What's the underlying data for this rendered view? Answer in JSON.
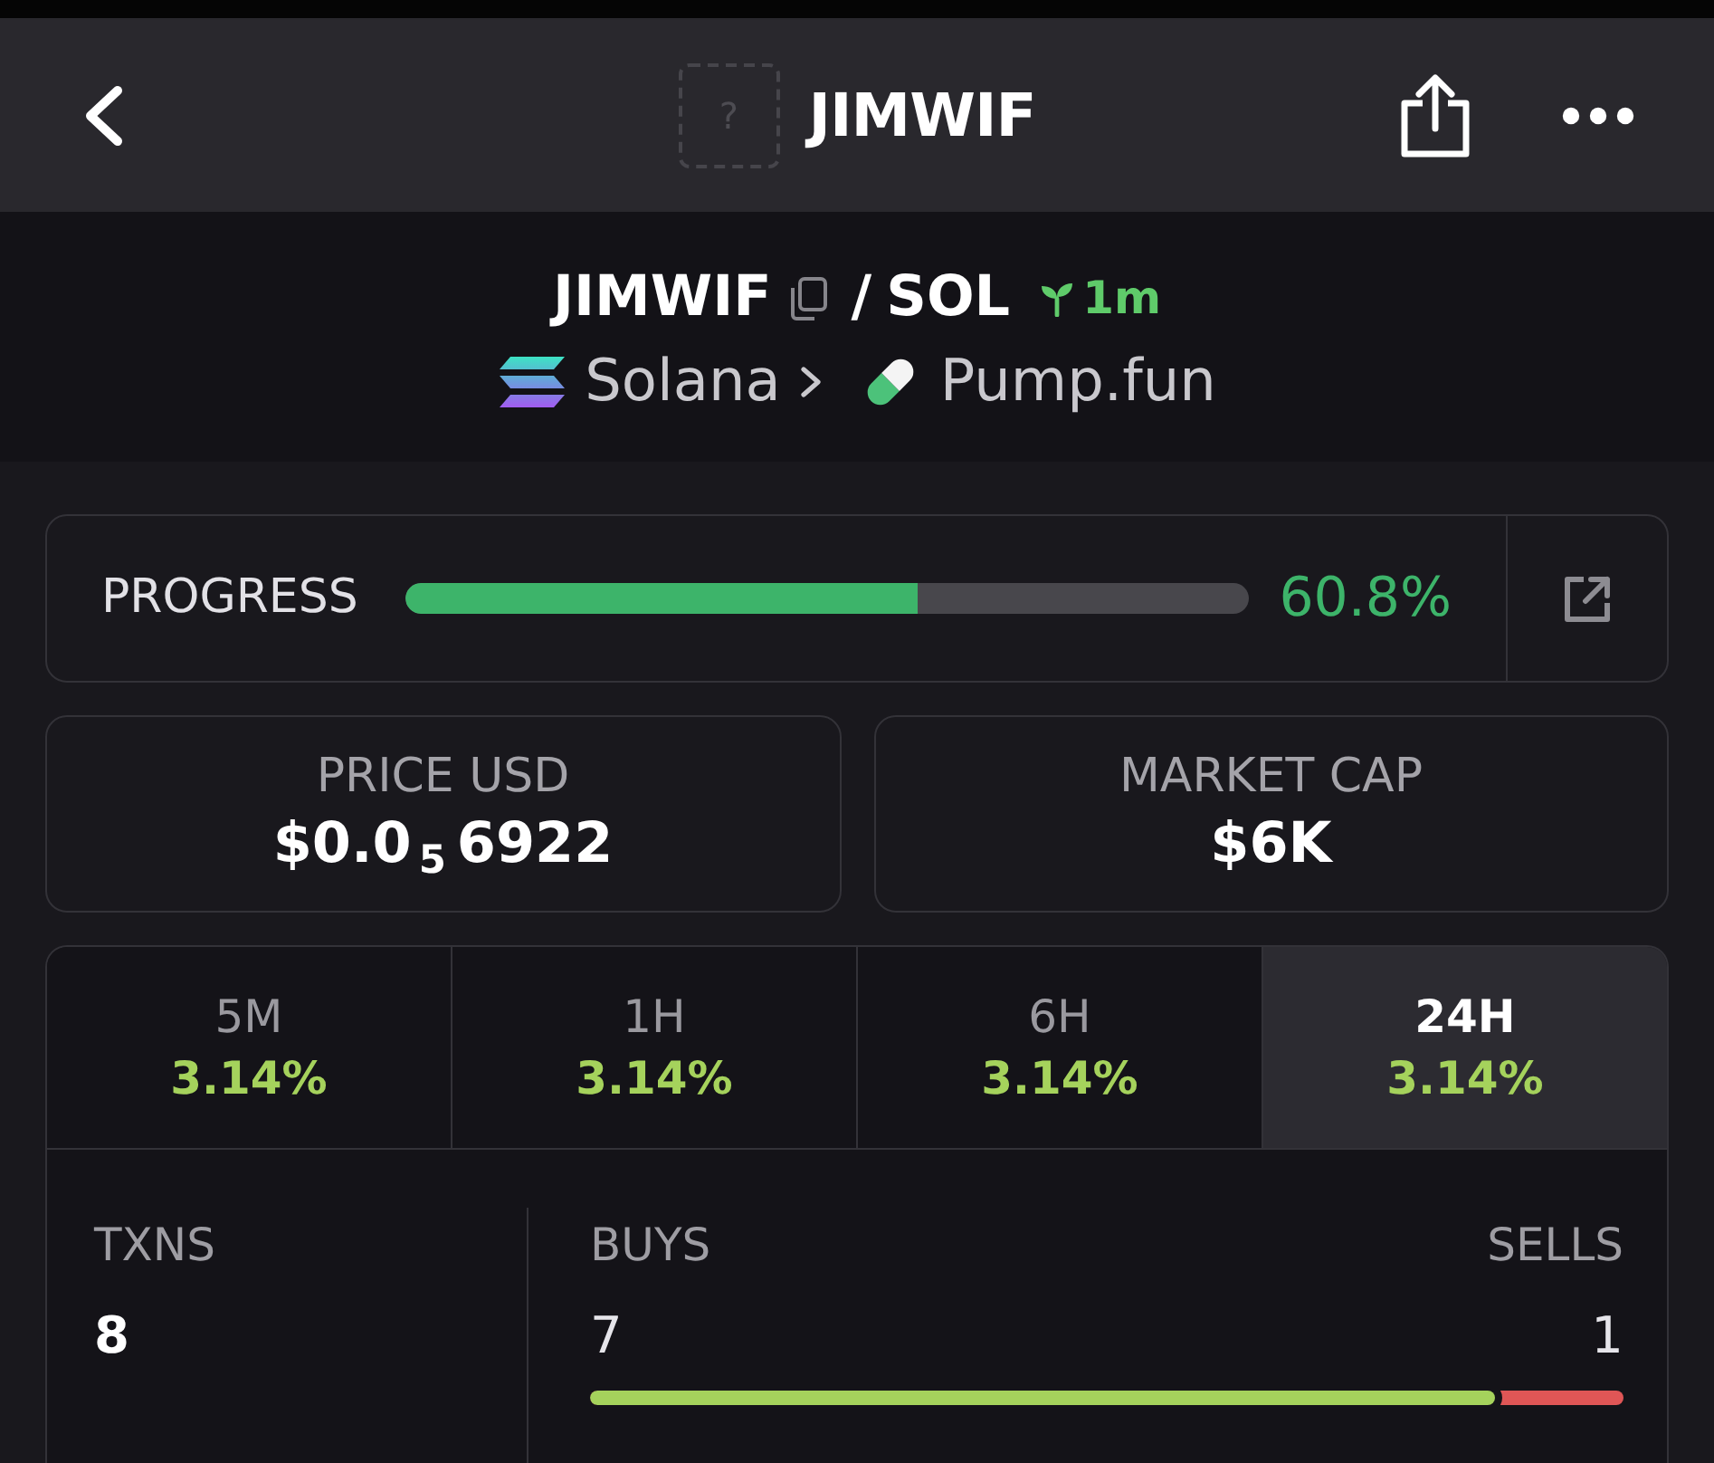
{
  "header": {
    "logo_glyph": "?",
    "title": "JIMWIF"
  },
  "pair": {
    "base": "JIMWIF",
    "separator": "/",
    "quote": "SOL",
    "age": "1m",
    "chain": "Solana",
    "dex": "Pump.fun"
  },
  "progress": {
    "label": "PROGRESS",
    "level": 0.608,
    "reading": "60.8%"
  },
  "stats": [
    {
      "label": "PRICE USD",
      "value": "$0.0$_{5}$6922"
    },
    {
      "label": "MARKET CAP",
      "value": "$6K"
    }
  ],
  "timeframes": [
    {
      "label": "5M",
      "change": "3.14%",
      "selected": false
    },
    {
      "label": "1H",
      "change": "3.14%",
      "selected": false
    },
    {
      "label": "6H",
      "change": "3.14%",
      "selected": false
    },
    {
      "label": "24H",
      "change": "3.14%",
      "selected": true
    }
  ],
  "txns": {
    "label": "TXNS",
    "value": "8"
  },
  "buys": {
    "label": "BUYS",
    "value": "7"
  },
  "sells": {
    "label": "SELLS",
    "value": "1"
  },
  "ratio": {
    "level": 0.875
  }
}
